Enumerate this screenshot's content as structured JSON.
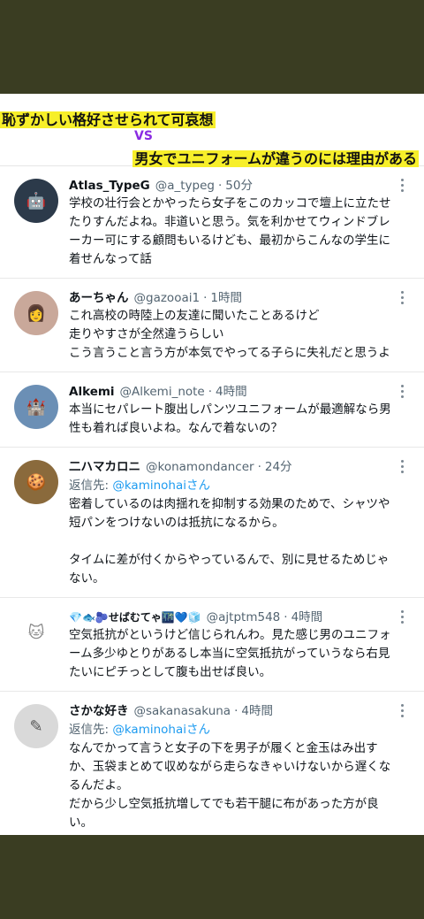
{
  "title": {
    "line1": "恥ずかしい格好させられて可哀想",
    "vs": "VS",
    "line2": "男女でユニフォームが違うのには理由がある"
  },
  "tweets": [
    {
      "name": "Atlas_TypeG",
      "handle": "@a_typeg",
      "time": "50分",
      "reply_prefix": "",
      "reply_to": "",
      "text": "学校の壮行会とかやったら女子をこのカッコで壇上に立たせたりすんだよね。非道いと思う。気を利かせてウィンドブレーカー可にする顧問もいるけども、最初からこんなの学生に着せんなって話",
      "avatar_color": "#2c3a4a",
      "avatar_icon": "robot-avatar-icon"
    },
    {
      "name": "あーちゃん",
      "handle": "@gazooai1",
      "time": "1時間",
      "reply_prefix": "",
      "reply_to": "",
      "text": "これ高校の時陸上の友達に聞いたことあるけど\n走りやすさが全然違うらしい\nこう言うこと言う方が本気でやってる子らに失礼だと思うよ",
      "avatar_color": "#c9a89a",
      "avatar_icon": "girl-avatar-icon"
    },
    {
      "name": "Alkemi",
      "handle": "@Alkemi_note",
      "time": "4時間",
      "reply_prefix": "",
      "reply_to": "",
      "text": "本当にセパレート腹出しパンツユニフォームが最適解なら男性も着れば良いよね。なんで着ないの？",
      "avatar_color": "#6b8fb5",
      "avatar_icon": "castle-avatar-icon"
    },
    {
      "name": "二ハマカロニ",
      "handle": "@konamondancer",
      "time": "24分",
      "reply_prefix": "返信先: ",
      "reply_to": "@kaminohaiさん",
      "text": "密着しているのは肉揺れを抑制する効果のためで、シャツや短パンをつけないのは抵抗になるから。\n\nタイムに差が付くからやっているんで、別に見せるためじゃない。",
      "avatar_color": "#8a6a3c",
      "avatar_icon": "food-avatar-icon"
    },
    {
      "name": "💎🐟🫐せばむてゃ🌃💙🧊",
      "handle": "@ajtptm548",
      "time": "4時間",
      "reply_prefix": "",
      "reply_to": "",
      "text": "空気抵抗がというけど信じられんわ。見た感じ男のユニフォーム多少ゆとりがあるし本当に空気抵抗がっていうなら右見たいにピチっとして腹も出せば良い。",
      "avatar_color": "#cfcfcf",
      "avatar_icon": "cat-avatar-icon"
    },
    {
      "name": "さかな好き",
      "handle": "@sakanasakuna",
      "time": "4時間",
      "reply_prefix": "返信先: ",
      "reply_to": "@kaminohaiさん",
      "text": "なんでかって言うと女子の下を男子が履くと金玉はみ出すか、玉袋まとめて収めながら走らなきゃいけないから遅くなるんだよ。\nだから少し空気抵抗増してでも若干腿に布があった方が良い。\n男は。\n上は胸のある無しだね。",
      "avatar_color": "#d9d9d9",
      "avatar_icon": "sketch-avatar-icon"
    }
  ]
}
